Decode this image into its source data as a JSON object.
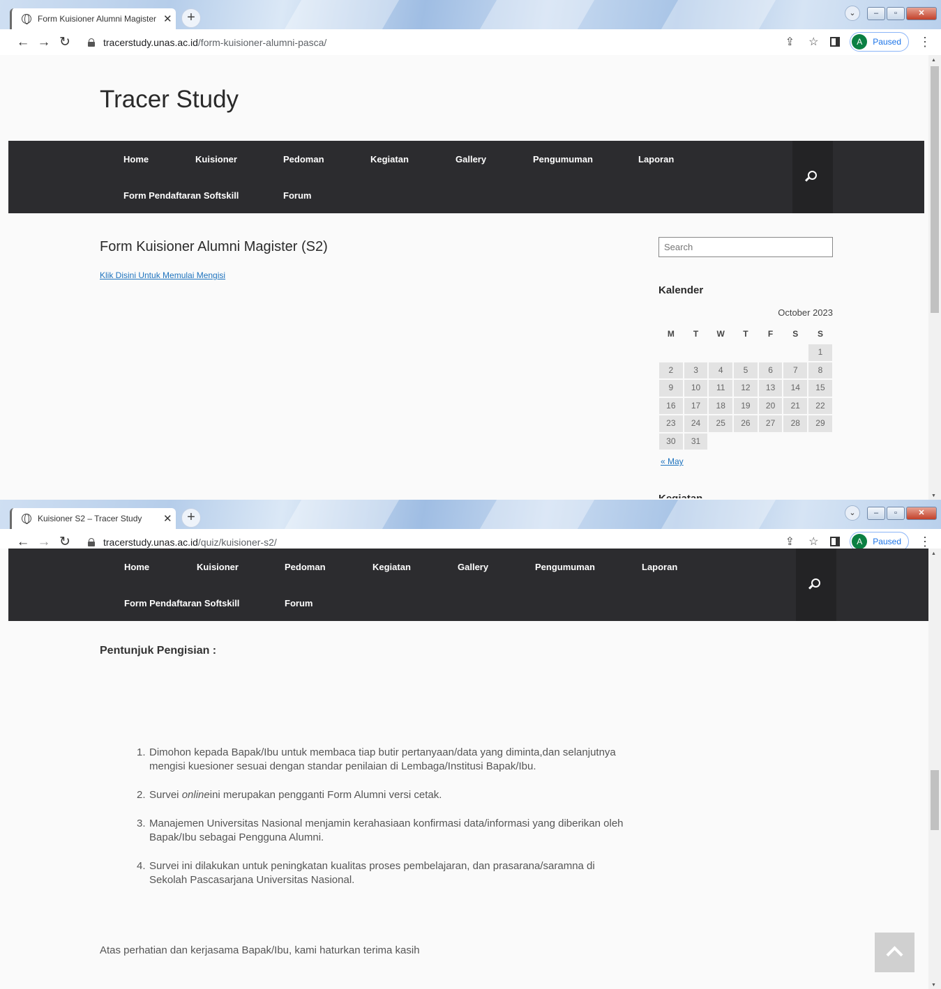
{
  "top_window": {
    "tab_title": "Form Kuisioner Alumni Magister",
    "url_host": "tracerstudy.unas.ac.id",
    "url_path": "/form-kuisioner-alumni-pasca/",
    "profile_initial": "A",
    "profile_status": "Paused",
    "site_title": "Tracer Study",
    "nav_row1": [
      "Home",
      "Kuisioner",
      "Pedoman",
      "Kegiatan",
      "Gallery",
      "Pengumuman",
      "Laporan"
    ],
    "nav_row2": [
      "Form Pendaftaran Softskill",
      "Forum"
    ],
    "post_title": "Form Kuisioner Alumni Magister (S2)",
    "post_link": "Klik Disini Untuk Memulai Mengisi",
    "search_placeholder": "Search",
    "calendar_title": "Kalender",
    "calendar_caption": "October 2023",
    "calendar_weekdays": [
      "M",
      "T",
      "W",
      "T",
      "F",
      "S",
      "S"
    ],
    "calendar_weeks": [
      [
        "",
        "",
        "",
        "",
        "",
        "",
        "1"
      ],
      [
        "2",
        "3",
        "4",
        "5",
        "6",
        "7",
        "8"
      ],
      [
        "9",
        "10",
        "11",
        "12",
        "13",
        "14",
        "15"
      ],
      [
        "16",
        "17",
        "18",
        "19",
        "20",
        "21",
        "22"
      ],
      [
        "23",
        "24",
        "25",
        "26",
        "27",
        "28",
        "29"
      ],
      [
        "30",
        "31",
        "",
        "",
        "",
        "",
        ""
      ]
    ],
    "calendar_prev": "« May",
    "next_widget_title_partial": "Kegiatan"
  },
  "bottom_window": {
    "tab_title": "Kuisioner S2 – Tracer Study",
    "url_host": "tracerstudy.unas.ac.id",
    "url_path": "/quiz/kuisioner-s2/",
    "profile_initial": "A",
    "profile_status": "Paused",
    "nav_row1": [
      "Home",
      "Kuisioner",
      "Pedoman",
      "Kegiatan",
      "Gallery",
      "Pengumuman",
      "Laporan"
    ],
    "nav_row2": [
      "Form Pendaftaran Softskill",
      "Forum"
    ],
    "instructions_heading": "Pentunjuk Pengisian :",
    "instructions": [
      {
        "num": "1.",
        "text": "Dimohon kepada Bapak/Ibu untuk membaca tiap butir pertanyaan/data yang diminta,dan selanjutnya mengisi kuesioner sesuai dengan standar penilaian di Lembaga/Institusi Bapak/Ibu."
      },
      {
        "num": "2.",
        "pre": "Survei ",
        "em": "online",
        "post": "ini merupakan pengganti Form Alumni versi cetak."
      },
      {
        "num": "3.",
        "text": "Manajemen Universitas Nasional menjamin kerahasiaan konfirmasi data/informasi yang diberikan oleh Bapak/Ibu sebagai Pengguna Alumni."
      },
      {
        "num": "4.",
        "text": "Survei ini dilakukan untuk peningkatan kualitas proses pembelajaran, dan prasarana/saramna di Sekolah Pascasarjana Universitas Nasional."
      }
    ],
    "thanks_text": "Atas perhatian dan kerjasama Bapak/Ibu, kami haturkan terima kasih"
  },
  "colors": {
    "nav_background": "#2c2c2f",
    "link": "#1e73be",
    "page_background": "#fafafa"
  },
  "icons": [
    "globe-icon",
    "close-icon",
    "plus-icon",
    "back-icon",
    "forward-icon",
    "reload-icon",
    "lock-icon",
    "share-icon",
    "star-icon",
    "side-panel-icon",
    "kebab-menu-icon",
    "search-icon",
    "chevron-up-icon"
  ]
}
